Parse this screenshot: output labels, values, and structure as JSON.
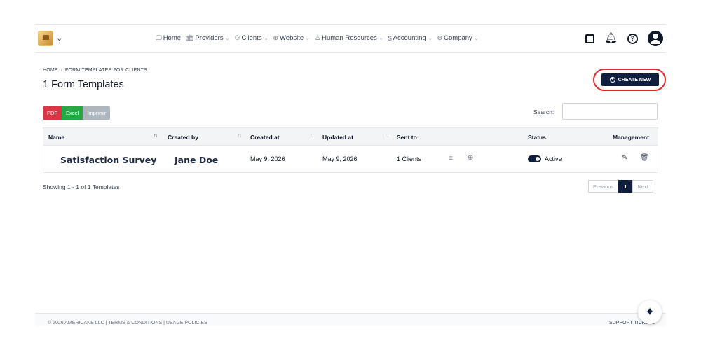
{
  "nav": {
    "items": [
      {
        "icon": "monitor-icon",
        "glyph": "🖵",
        "label": "Home",
        "dropdown": false
      },
      {
        "icon": "building-icon",
        "glyph": "🏛",
        "label": "Providers",
        "dropdown": true
      },
      {
        "icon": "users-icon",
        "glyph": "⚇",
        "label": "Clients",
        "dropdown": true
      },
      {
        "icon": "globe-icon",
        "glyph": "⊕",
        "label": "Website",
        "dropdown": true
      },
      {
        "icon": "user-icon",
        "glyph": "♙",
        "label": "Human Resources",
        "dropdown": true
      },
      {
        "icon": "dollar-icon",
        "glyph": "$",
        "label": "Accounting",
        "dropdown": true
      },
      {
        "icon": "company-icon",
        "glyph": "⊛",
        "label": "Company",
        "dropdown": true
      }
    ]
  },
  "breadcrumb": {
    "home": "HOME",
    "current": "FORM TEMPLATES FOR CLIENTS"
  },
  "page_title": "1 Form Templates",
  "create_button": "CREATE NEW",
  "exports": {
    "pdf": "PDF",
    "excel": "Excel",
    "print": "Imprimir"
  },
  "search": {
    "label": "Search:",
    "value": ""
  },
  "table": {
    "headers": {
      "name": "Name",
      "created_by": "Created by",
      "created_at": "Created at",
      "updated_at": "Updated at",
      "sent_to": "Sent to",
      "status": "Status",
      "management": "Management"
    },
    "rows": [
      {
        "name": "Satisfaction Survey",
        "created_by": "Jane Doe",
        "created_at": "May 9, 2026",
        "updated_at": "May 9, 2026",
        "sent_to": "1 Clients",
        "status": "Active"
      }
    ]
  },
  "showing": "Showing 1 - 1 of 1 Templates",
  "pagination": {
    "previous": "Previous",
    "page": "1",
    "next": "Next"
  },
  "footer": {
    "left": "© 2026 AMERICANE LLC | TERMS & CONDITIONS | USAGE POLICIES",
    "right": "SUPPORT TICKETS"
  },
  "colors": {
    "primary": "#0f1f3d",
    "highlight": "#e0282e",
    "pdf": "#dc3545",
    "excel": "#28a745",
    "print": "#adb5bd"
  }
}
